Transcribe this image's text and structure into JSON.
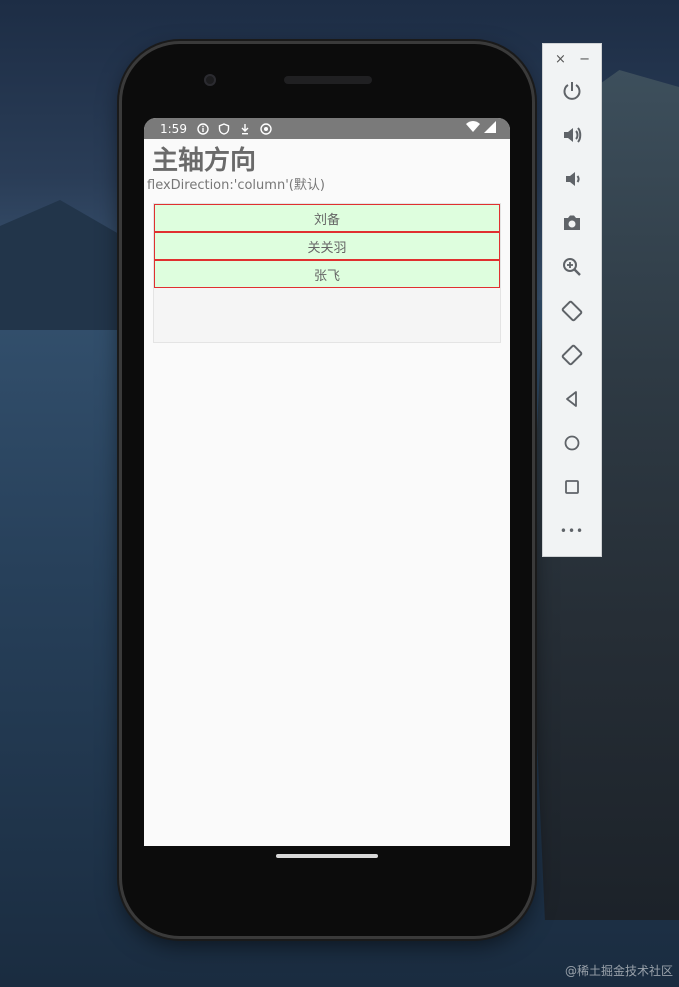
{
  "status_bar": {
    "time": "1:59"
  },
  "page": {
    "title": "主轴方向",
    "subtitle": "flexDirection:'column'(默认)"
  },
  "flex_items": [
    "刘备",
    "关关羽",
    "张飞"
  ],
  "emulator_toolbar": {
    "close_label": "×",
    "minimize_label": "−",
    "more_label": "•••",
    "buttons": [
      "power-icon",
      "volume-up-icon",
      "volume-down-icon",
      "camera-icon",
      "zoom-icon",
      "rotate-left-icon",
      "rotate-right-icon",
      "back-icon",
      "home-icon",
      "overview-icon",
      "more-icon"
    ]
  },
  "watermark": "@稀土掘金技术社区",
  "colors": {
    "item_background": "#defede",
    "item_border": "#e03030",
    "status_bar": "#7a7a7a"
  }
}
